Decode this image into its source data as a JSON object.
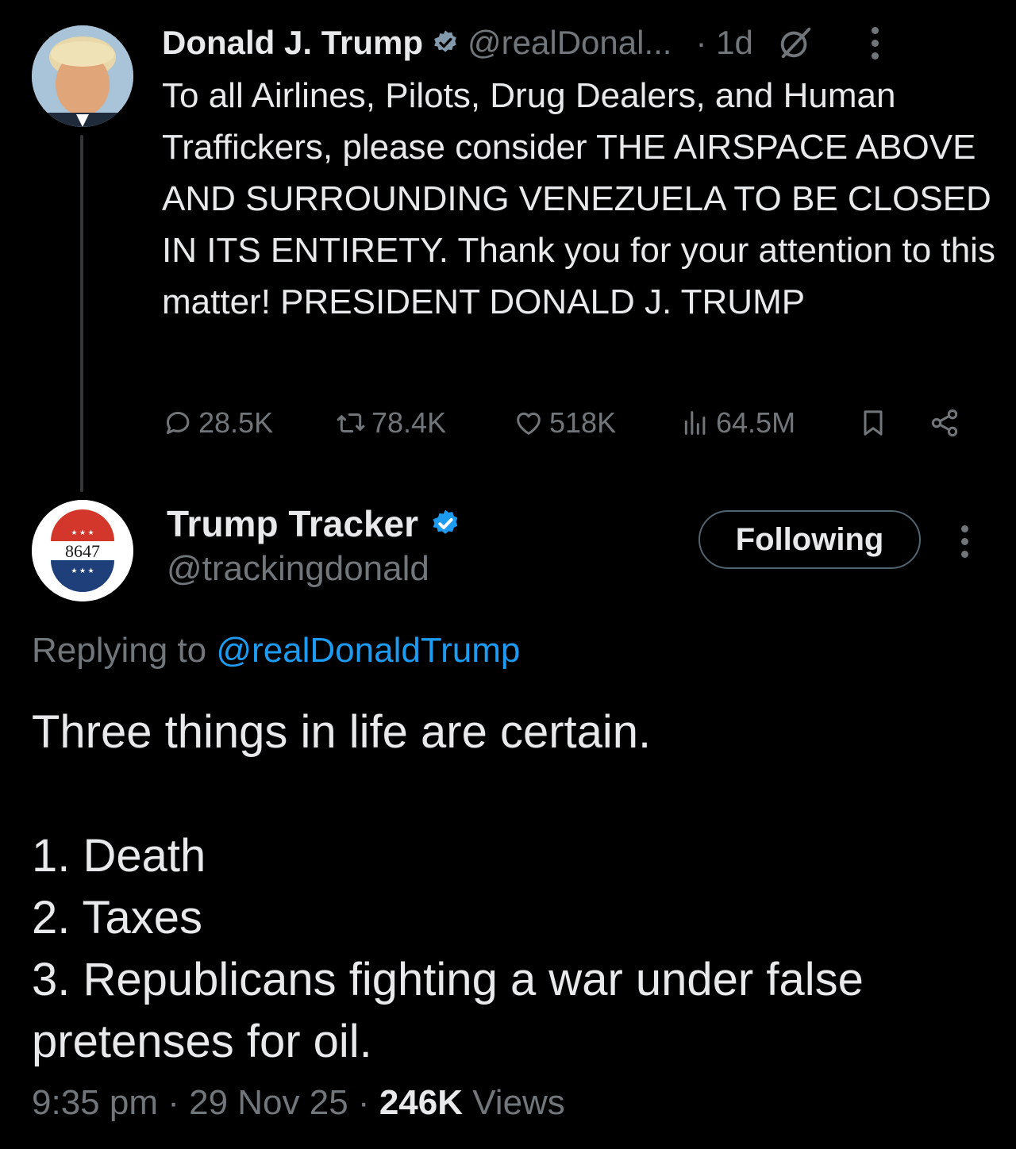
{
  "colors": {
    "background": "#000000",
    "text": "#e7e9ea",
    "muted": "#71767b",
    "accent": "#1d9bf0"
  },
  "original_post": {
    "author_name": "Donald J. Trump",
    "handle": "@realDonal...",
    "time": "· 1d",
    "text": "To all Airlines, Pilots, Drug Dealers, and Human Traffickers, please consider THE AIRSPACE ABOVE AND SURROUNDING VENEZUELA TO BE CLOSED IN ITS ENTIRETY. Thank you for your attention to this matter! PRESIDENT DONALD J. TRUMP",
    "stats": {
      "replies": "28.5K",
      "reposts": "78.4K",
      "likes": "518K",
      "views": "64.5M"
    },
    "icons": [
      "verified-badge-icon",
      "grok-icon",
      "more-icon",
      "reply-icon",
      "repost-icon",
      "like-icon",
      "views-icon",
      "bookmark-icon",
      "share-icon"
    ]
  },
  "reply_post": {
    "author_name": "Trump Tracker",
    "handle": "@trackingdonald",
    "avatar_text": "8647",
    "follow_label": "Following",
    "replying_prefix": "Replying to",
    "replying_to": "@realDonaldTrump",
    "lines": [
      "Three things in life are certain.",
      "",
      "1. Death",
      "2. Taxes",
      "3. Republicans fighting a war under false pretenses for oil."
    ],
    "time": "9:35 pm",
    "date": "29 Nov 25",
    "views_count": "246K",
    "views_label": "Views"
  }
}
